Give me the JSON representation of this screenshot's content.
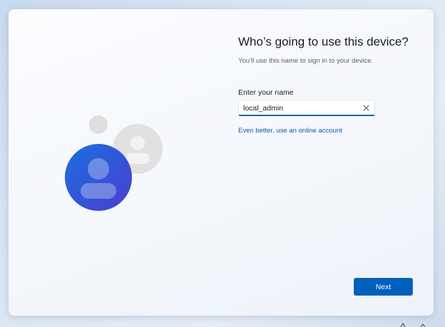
{
  "setup": {
    "title": "Who’s going to use this device?",
    "subtitle": "You’ll use this name to sign in to your device.",
    "name_label": "Enter your name",
    "name_value": "local_admin",
    "online_account_link": "Even better, use an online account",
    "next_label": "Next"
  },
  "icons": {
    "avatar_illustration": "user-avatar-icon",
    "clear": "close-icon"
  },
  "colors": {
    "accent": "#0060bd",
    "link": "#0b5aa6",
    "avatar_primary": "#1f63d6",
    "avatar_secondary": "#dcdcdc"
  }
}
